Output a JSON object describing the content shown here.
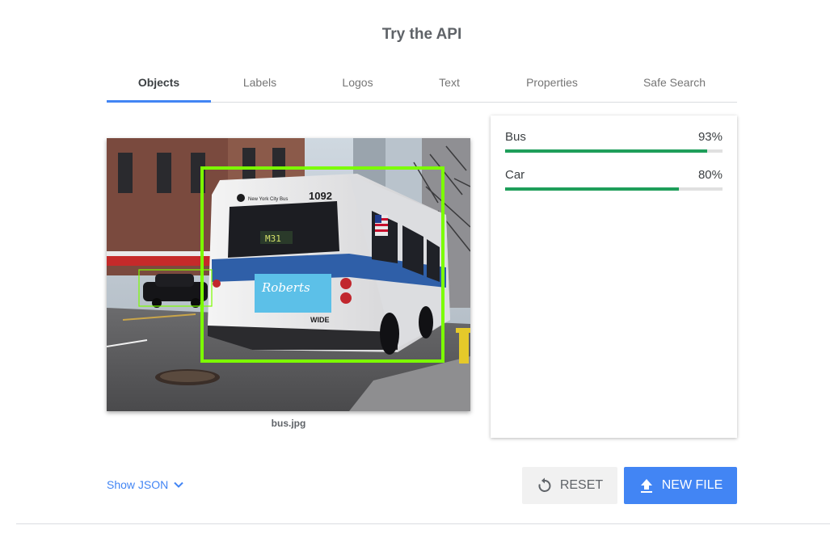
{
  "header": {
    "title": "Try the API"
  },
  "tabs": [
    {
      "label": "Objects",
      "active": true
    },
    {
      "label": "Labels",
      "active": false
    },
    {
      "label": "Logos",
      "active": false
    },
    {
      "label": "Text",
      "active": false
    },
    {
      "label": "Properties",
      "active": false
    },
    {
      "label": "Safe Search",
      "active": false
    }
  ],
  "image": {
    "filename": "bus.jpg",
    "bus_route_sign": "M31",
    "bus_number": "1092",
    "bus_operator_text": "New York City Bus",
    "ad_brand_text": "Roberts",
    "bumper_text": "WIDE"
  },
  "results": [
    {
      "label": "Bus",
      "percent_text": "93%",
      "score": 0.93
    },
    {
      "label": "Car",
      "percent_text": "80%",
      "score": 0.8
    }
  ],
  "footer": {
    "show_json_label": "Show JSON",
    "reset_label": "RESET",
    "new_file_label": "NEW FILE"
  },
  "colors": {
    "accent": "#4285f4",
    "bar_fill": "#1e9e5a",
    "bar_track": "#e0e0e0",
    "bounding_box": "#7cfc00"
  },
  "icons": {
    "chevron": "chevron-down-icon",
    "reset": "reset-icon",
    "upload": "upload-icon"
  }
}
